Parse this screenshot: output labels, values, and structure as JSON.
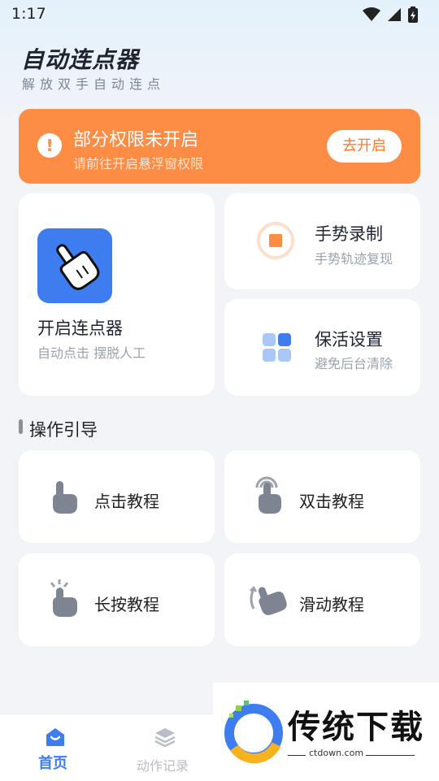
{
  "status": {
    "time": "1:17"
  },
  "app": {
    "title": "自动连点器",
    "subtitle": "解放双手自动连点"
  },
  "banner": {
    "title": "部分权限未开启",
    "subtitle": "请前往开启悬浮窗权限",
    "button": "去开启",
    "icon": "exclamation-icon"
  },
  "cards": {
    "clicker": {
      "title": "开启连点器",
      "subtitle": "自动点击 摆脱人工"
    },
    "gesture": {
      "title": "手势录制",
      "subtitle": "手势轨迹复现"
    },
    "keepalive": {
      "title": "保活设置",
      "subtitle": "避免后台清除"
    }
  },
  "section": {
    "title": "操作引导"
  },
  "tutorials": [
    {
      "label": "点击教程",
      "icon": "tap-hand-icon"
    },
    {
      "label": "双击教程",
      "icon": "double-tap-hand-icon"
    },
    {
      "label": "长按教程",
      "icon": "long-press-hand-icon"
    },
    {
      "label": "滑动教程",
      "icon": "swipe-hand-icon"
    }
  ],
  "tabs": [
    {
      "label": "首页",
      "icon": "home-icon",
      "active": true
    },
    {
      "label": "动作记录",
      "icon": "layers-icon",
      "active": false
    }
  ],
  "watermark": {
    "name": "传统下载",
    "url": "ctdown.com"
  },
  "colors": {
    "accent": "#3d7df0",
    "banner": "#fd8c45",
    "gesture": "#fd8c45",
    "tab_active": "#3d7df0"
  }
}
